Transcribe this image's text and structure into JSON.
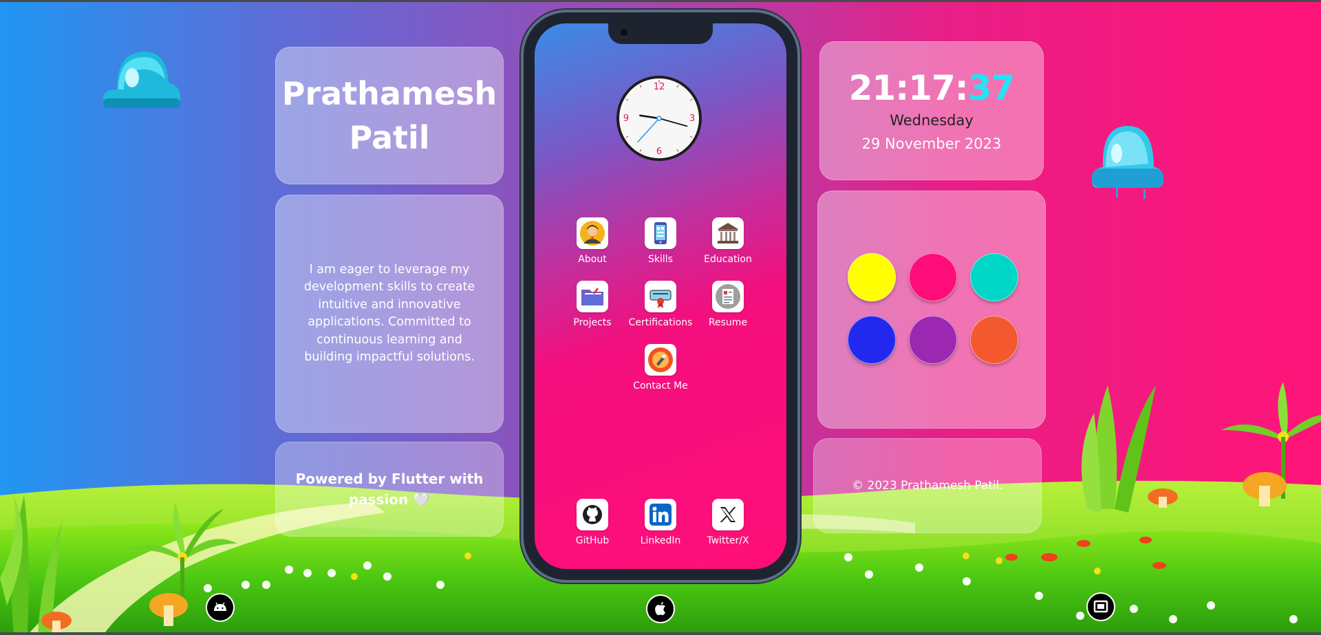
{
  "profile": {
    "name_line1": "Prathamesh",
    "name_line2": "Patil",
    "bio": "I am eager to leverage my development skills to create intuitive and innovative applications. Committed to continuous learning and building impactful solutions.",
    "powered_by": "Powered by Flutter with passion 🤍"
  },
  "clock_widget": {
    "hours_minutes": "21:17:",
    "seconds": "37",
    "day": "Wednesday",
    "date": "29 November 2023"
  },
  "analog_clock": {
    "numerals": [
      "12",
      "3",
      "6",
      "9"
    ],
    "time": "21:17:37"
  },
  "theme_colors": [
    {
      "name": "yellow",
      "hex": "#ffff00"
    },
    {
      "name": "pink",
      "hex": "#ff0d7a"
    },
    {
      "name": "teal",
      "hex": "#00d6c6"
    },
    {
      "name": "blue",
      "hex": "#2228ee"
    },
    {
      "name": "purple",
      "hex": "#9c27b0"
    },
    {
      "name": "orange",
      "hex": "#f4582f"
    }
  ],
  "footer": {
    "copyright": "© 2023 Prathamesh Patil."
  },
  "apps": [
    {
      "label": "About",
      "icon": "user-avatar-icon"
    },
    {
      "label": "Skills",
      "icon": "phone-skills-icon"
    },
    {
      "label": "Education",
      "icon": "institution-icon"
    },
    {
      "label": "Projects",
      "icon": "folder-icon"
    },
    {
      "label": "Certifications",
      "icon": "certificate-icon"
    },
    {
      "label": "Resume",
      "icon": "resume-icon"
    },
    {
      "label": "Contact Me",
      "icon": "contact-icon"
    }
  ],
  "dock": [
    {
      "label": "GitHub",
      "icon": "github-icon"
    },
    {
      "label": "LinkedIn",
      "icon": "linkedin-icon"
    },
    {
      "label": "Twitter/X",
      "icon": "x-icon"
    }
  ],
  "platforms": [
    "android-icon",
    "apple-icon",
    "windows-icon"
  ]
}
